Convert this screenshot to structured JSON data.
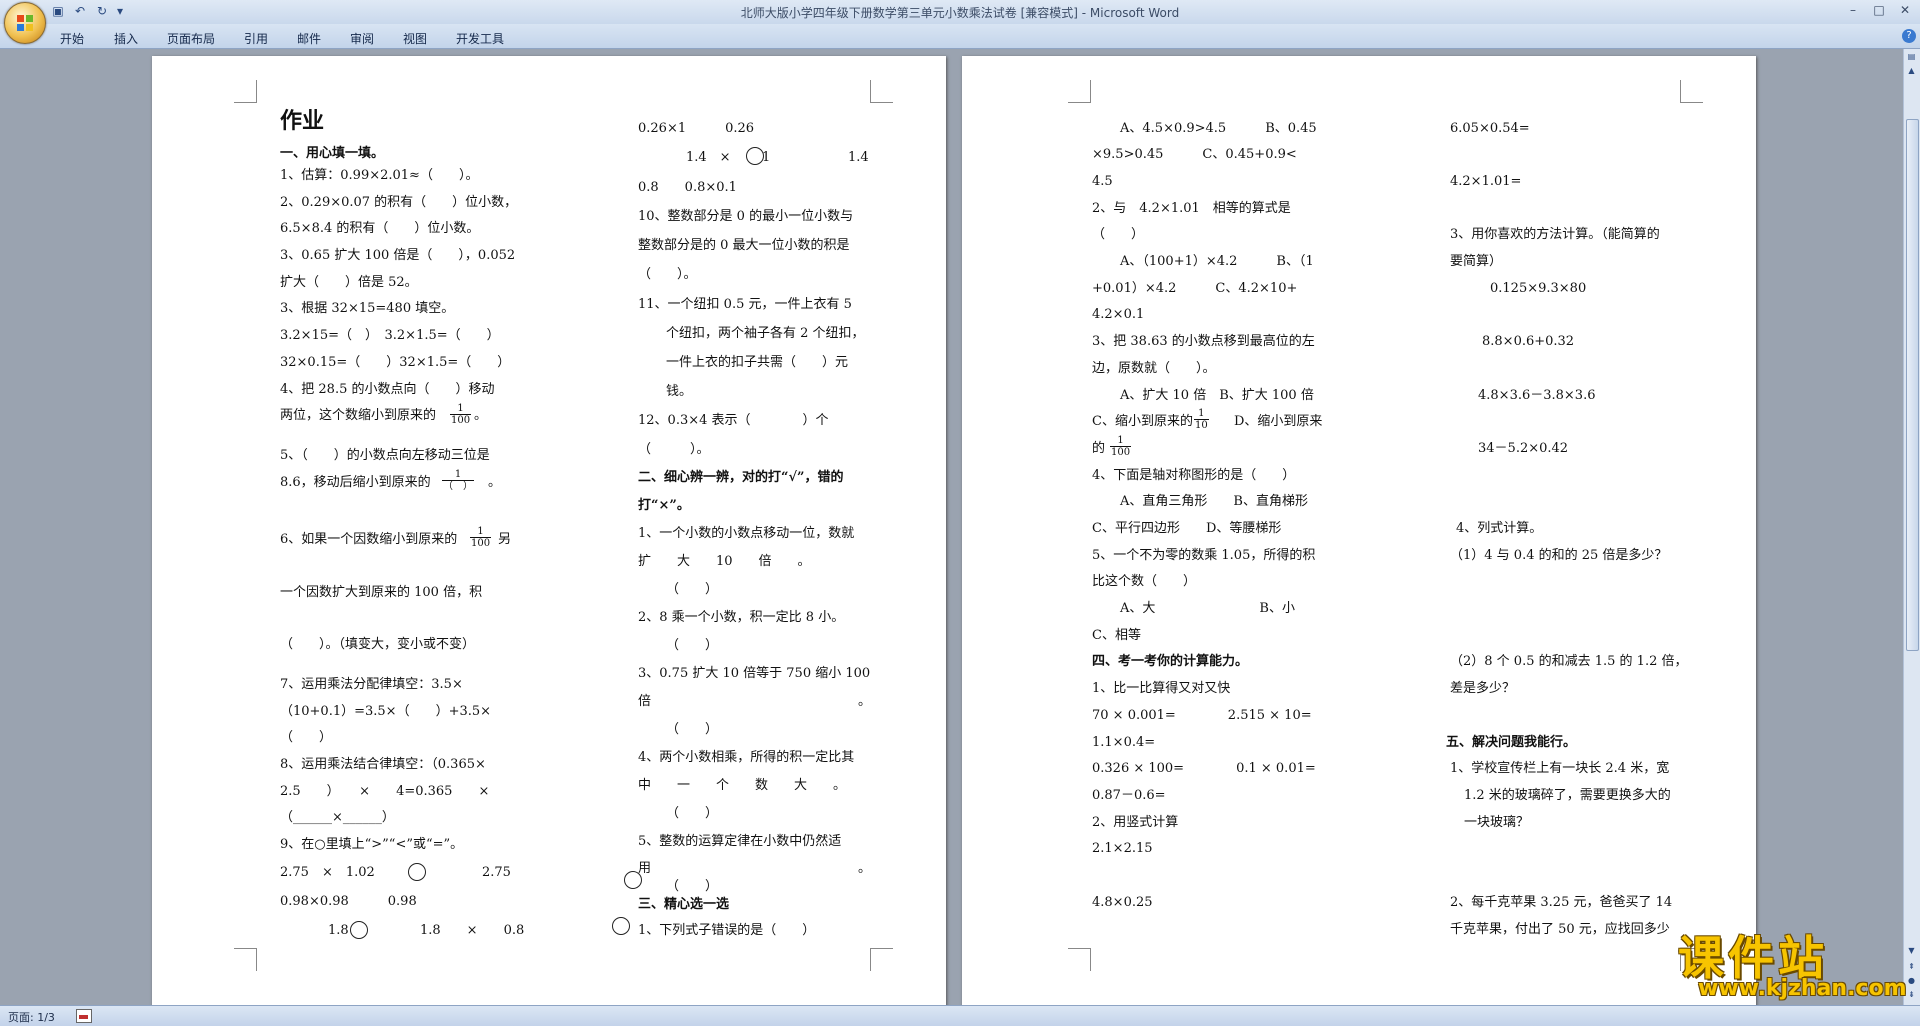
{
  "window": {
    "title": "北师大版小学四年级下册数学第三单元小数乘法试卷 [兼容模式] - Microsoft Word",
    "minimize": "–",
    "maximize": "□",
    "close": "✕"
  },
  "quick_access": {
    "save_icon": "save-icon",
    "undo_icon": "undo-icon",
    "redo_icon": "redo-icon",
    "customize": "▾"
  },
  "ribbon": {
    "tabs": [
      "开始",
      "插入",
      "页面布局",
      "引用",
      "邮件",
      "审阅",
      "视图",
      "开发工具"
    ],
    "help": "?"
  },
  "status": {
    "page": "页面: 1/3"
  },
  "watermark": {
    "main": "课件站",
    "url": "www.kjzhan.com"
  },
  "p1c1": {
    "title": "作业",
    "sec1": "一、用心填一填。",
    "l1": "1、估算：0.99×2.01≈（　　）。",
    "l2": "2、0.29×0.07 的积有（　　）位小数，",
    "l3": "6.5×8.4 的积有（　　）位小数。",
    "l4": "3、0.65 扩大 100 倍是（　　），0.052",
    "l5": "扩大（　　）倍是 52。",
    "l6": "3、根据 32×15=480 填空。",
    "l7": "3.2×15=（　）　3.2×1.5=（　　）",
    "l8": "32×0.15=（　　）32×1.5=（　　）",
    "l9": "4、把 28.5 的小数点向（　　）移动",
    "l10": "两位，这个数缩小到原来的",
    "l10b": "。",
    "f1n": "1",
    "f1d": "100",
    "l11": "5、（　　）的小数点向左移动三位是",
    "l12": "8.6，移动后缩小到原来的",
    "l12b": "。",
    "f2n": "1",
    "f2d": "（　）",
    "l13": "6、如果一个因数缩小到原来的",
    "l13b": "另",
    "f3n": "1",
    "f3d": "100",
    "l14": "一个因数扩大到原来的 100 倍，积",
    "l15": "（　　）。（填变大，变小或不变）",
    "l16": "7、运用乘法分配律填空：3.5×",
    "l17": "（10+0.1）=3.5×（　　）+3.5×",
    "l18": "（　　）",
    "l19": "8、运用乘法结合律填空：（0.365×",
    "l20": "2.5　　）　　×　　4=0.365　　×",
    "l21": "（______×______）",
    "l22": "9、在○里填上“>”“<”或“=”。",
    "l23a": "2.75　×　1.02",
    "l23b": "2.75",
    "l24": "0.98×0.98　　　0.98",
    "l25a": "1.8",
    "l25b": "1.8　　×　　0.8"
  },
  "p1c2": {
    "l1": "0.26×1　　　0.26",
    "l2a": "1.4　×",
    "l2b": "1",
    "l2c": "1.4",
    "l3": "0.8　　0.8×0.1",
    "l4": "10、整数部分是 0 的最小一位小数与",
    "l5": "整数部分是的 0 最大一位小数的积是",
    "l6": "（　　）。",
    "l7": "11、一个纽扣 0.5 元，一件上衣有 5",
    "l8": "个纽扣，两个袖子各有 2 个纽扣，",
    "l9": "一件上衣的扣子共需（　　）元",
    "l10": "钱。",
    "l11": "12、0.3×4 表示（　　　　）个",
    "l12": "（　　　）。",
    "sec2": "二、细心辨一辨，对的打“√”，错的",
    "sec2b": "打“×”。",
    "l13": "1、一个小数的小数点移动一位，数就",
    "l14": "扩　　大　　10　　倍　　。",
    "l15": "（　　）",
    "l16": "2、8 乘一个小数，积一定比 8 小。",
    "l17": "（　　）",
    "l18": "3、0.75 扩大 10 倍等于 750 缩小 100",
    "l19a": "倍",
    "l19b": "。",
    "l20": "（　　）",
    "l21": "4、两个小数相乘，所得的积一定比其",
    "l22": "中　　一　　个　　数　　大　　。",
    "l23": "（　　）",
    "l24": "5、整数的运算定律在小数中仍然适",
    "l25a": "用",
    "l25b": "。",
    "l26": "（　　）",
    "sec3": "三、精心选一选",
    "l27": "1、下列式子错误的是（　　）"
  },
  "p2c1": {
    "l1": "A、4.5×0.9>4.5　　　B、0.45",
    "l2": "×9.5>0.45　　　C、0.45+0.9<",
    "l3": "4.5",
    "l4": "2、与　4.2×1.01　相等的算式是",
    "l5": "（　　）",
    "l6": "A、（100+1）×4.2　　　B、（1",
    "l7": "+0.01）×4.2　　　C、4.2×10+",
    "l8": "4.2×0.1",
    "l9": "3、把 38.63 的小数点移到最高位的左",
    "l10": "边，原数就（　　）。",
    "l11": "A、扩大 10 倍　B、扩大 100 倍",
    "l12a": "C、缩小到原来的",
    "l12b": "D、缩小到原来",
    "f1n": "1",
    "f1d": "10",
    "l13": "的",
    "f2n": "1",
    "f2d": "100",
    "l14": "4、下面是轴对称图形的是（　　）",
    "l15": "A、直角三角形　　B、直角梯形",
    "l16": "C、平行四边形　　D、等腰梯形",
    "l17": "5、一个不为零的数乘 1.05，所得的积",
    "l18": "比这个数（　　）",
    "l19": "A、大　　　　　　　　B、小",
    "l20": "C、相等",
    "sec4": "四、考一考你的计算能力。",
    "l21": "1、比一比算得又对又快",
    "l22": "70 × 0.001=　　　　2.515 × 10=",
    "l23": "1.1×0.4=",
    "l24": "0.326 × 100=　　　　0.1 × 0.01=",
    "l25": "0.87－0.6=",
    "l26": "2、用竖式计算",
    "l27": "2.1×2.15",
    "l28": "4.8×0.25"
  },
  "p2c2": {
    "l1": "6.05×0.54=",
    "l2": "4.2×1.01=",
    "l3": "3、用你喜欢的方法计算。（能简算的",
    "l4": "要简算）",
    "l5": "0.125×9.3×80",
    "l6": "8.8×0.6+0.32",
    "l7": "4.8×3.6－3.8×3.6",
    "l8": "34－5.2×0.42",
    "l9": "4、列式计算。",
    "l10": "（1）4 与 0.4 的和的 25 倍是多少？",
    "l11": "（2）8 个 0.5 的和减去 1.5 的 1.2 倍，",
    "l12": "差是多少？",
    "sec5": "五、解决问题我能行。",
    "l13": "1、学校宣传栏上有一块长 2.4 米，宽",
    "l14": "1.2 米的玻璃碎了，需要更换多大的",
    "l15": "一块玻璃？",
    "l16": "2、每千克苹果 3.25 元，爸爸买了 14",
    "l17": "千克苹果，付出了 50 元，应找回多少"
  }
}
